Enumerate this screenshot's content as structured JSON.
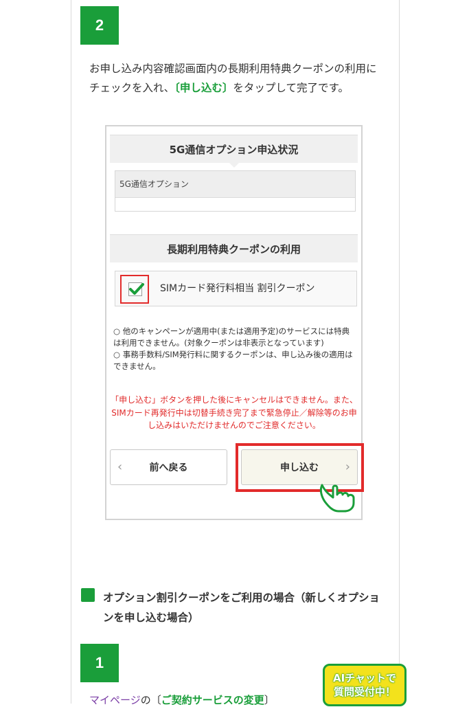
{
  "steps": {
    "step2_number": "2",
    "step1_number": "1"
  },
  "intro": {
    "before": "お申し込み内容確認画面内の長期利用特典クーポンの利用にチェックを入れ、",
    "highlight": "〔申し込む〕",
    "after": "をタップして完了です。"
  },
  "screenshot": {
    "section1_title": "5G通信オプション申込状況",
    "option_label": "5G通信オプション",
    "section2_title": "長期利用特典クーポンの利用",
    "coupon_label": "SIMカード発行料相当 割引クーポン",
    "coupon_checked": true,
    "notes": [
      "○ 他のキャンペーンが適用中(または適用予定)のサービスには特典は利用できません。(対象クーポンは非表示となっています)",
      "○ 事務手数料/SIM発行料に関するクーポンは、申し込み後の適用はできません。"
    ],
    "warning": "「申し込む」ボタンを押した後にキャンセルはできません。また、SIMカード再発行中は切替手続き完了まで緊急停止／解除等のお申し込みはいただけませんのでご注意ください。",
    "back_button": "前へ戻る",
    "submit_button": "申し込む",
    "chevron_left": "‹",
    "chevron_right": "›"
  },
  "subsection": {
    "title": "オプション割引クーポンをご利用の場合（新しくオプションを申し込む場合）"
  },
  "bottom": {
    "link_text": "マイページ",
    "middle": "の〔",
    "highlight": "ご契約サービスの変更",
    "end": "〕"
  },
  "ai_chat": {
    "line1": "AIチャットで",
    "line2": "質問受付中！"
  },
  "colors": {
    "brand_green": "#1a9e3a",
    "highlight_red": "#e22b2b",
    "ai_yellow": "#f3e21c"
  }
}
